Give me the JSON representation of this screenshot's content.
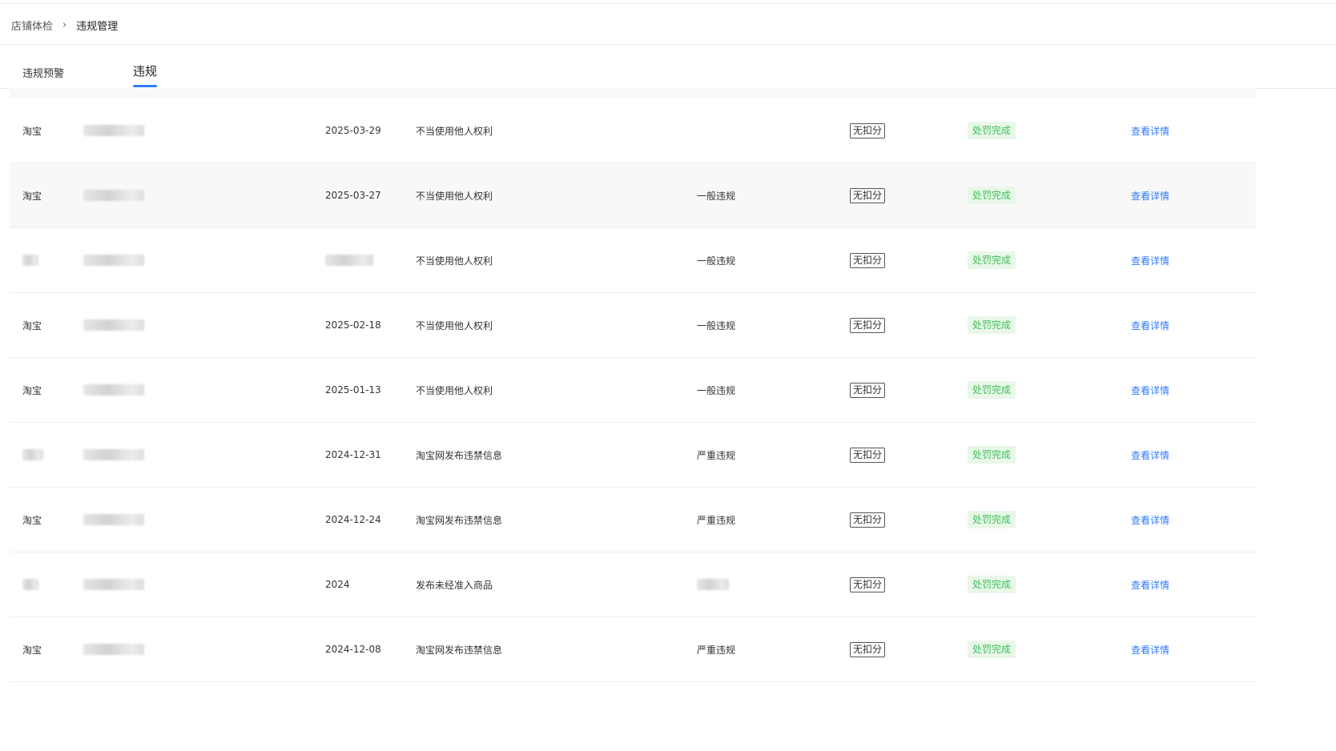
{
  "breadcrumb": {
    "parent": "店铺体检",
    "separator": "›",
    "current": "违规管理"
  },
  "tabs": [
    {
      "label": "违规预警",
      "active": false
    },
    {
      "label": "违规",
      "active": true
    }
  ],
  "colors": {
    "accent": "#2f7bff",
    "status_green": "#3fbf5a",
    "status_bg": "#e9f7e9"
  },
  "rows": [
    {
      "platform": "淘宝",
      "date": "2025-03-29",
      "reason": "不当使用他人权利",
      "level": "",
      "points": "无扣分",
      "status": "处罚完成",
      "action": "查看详情"
    },
    {
      "platform": "淘宝",
      "date": "2025-03-27",
      "reason": "不当使用他人权利",
      "level": "一般违规",
      "points": "无扣分",
      "status": "处罚完成",
      "action": "查看详情"
    },
    {
      "platform": "",
      "date": "",
      "reason": "不当使用他人权利",
      "level": "一般违规",
      "points": "无扣分",
      "status": "处罚完成",
      "action": "查看详情"
    },
    {
      "platform": "淘宝",
      "date": "2025-02-18",
      "reason": "不当使用他人权利",
      "level": "一般违规",
      "points": "无扣分",
      "status": "处罚完成",
      "action": "查看详情"
    },
    {
      "platform": "淘宝",
      "date": "2025-01-13",
      "reason": "不当使用他人权利",
      "level": "一般违规",
      "points": "无扣分",
      "status": "处罚完成",
      "action": "查看详情"
    },
    {
      "platform": "",
      "date": "2024-12-31",
      "reason": "淘宝网发布违禁信息",
      "level": "严重违规",
      "points": "无扣分",
      "status": "处罚完成",
      "action": "查看详情"
    },
    {
      "platform": "淘宝",
      "date": "2024-12-24",
      "reason": "淘宝网发布违禁信息",
      "level": "严重违规",
      "points": "无扣分",
      "status": "处罚完成",
      "action": "查看详情"
    },
    {
      "platform": "",
      "date": "2024",
      "reason": "发布未经准入商品",
      "level": "",
      "points": "无扣分",
      "status": "处罚完成",
      "action": "查看详情"
    },
    {
      "platform": "淘宝",
      "date": "2024-12-08",
      "reason": "淘宝网发布违禁信息",
      "level": "严重违规",
      "points": "无扣分",
      "status": "处罚完成",
      "action": "查看详情"
    }
  ]
}
